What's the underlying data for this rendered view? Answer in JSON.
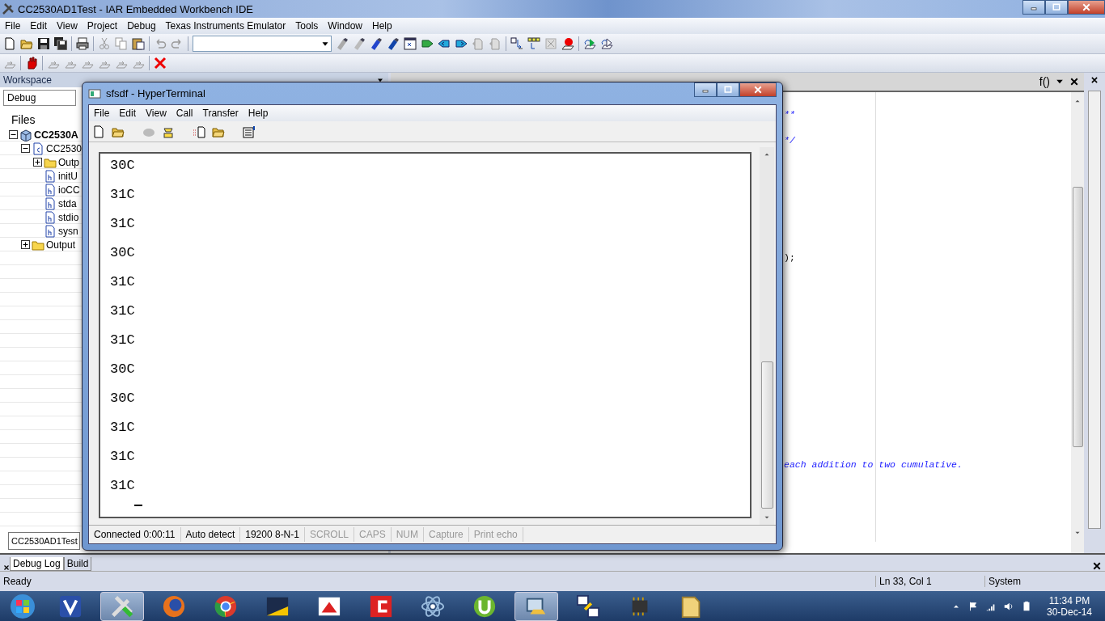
{
  "ide": {
    "title": "CC2530AD1Test - IAR Embedded Workbench IDE",
    "menu": [
      "File",
      "Edit",
      "View",
      "Project",
      "Debug",
      "Texas Instruments Emulator",
      "Tools",
      "Window",
      "Help"
    ],
    "workspace": {
      "title": "Workspace",
      "configuration": "Debug",
      "files_header": "Files",
      "tree": [
        {
          "label": "CC2530A",
          "kind": "project",
          "expanded": true,
          "children": [
            {
              "label": "CC2530",
              "kind": "c",
              "expanded": true,
              "children": [
                {
                  "label": "Outp",
                  "kind": "folder",
                  "expanded": false
                },
                {
                  "label": "initU",
                  "kind": "h"
                },
                {
                  "label": "ioCC",
                  "kind": "h"
                },
                {
                  "label": "stda",
                  "kind": "h"
                },
                {
                  "label": "stdio",
                  "kind": "h"
                },
                {
                  "label": "sysn",
                  "kind": "h"
                }
              ]
            },
            {
              "label": "Output",
              "kind": "folder",
              "expanded": false
            }
          ]
        }
      ],
      "tab": "CC2530AD1Test"
    },
    "editor": {
      "function_button": "f()",
      "lines": [
        {
          "text": "**",
          "kind": "comment"
        },
        {
          "text": "*/",
          "kind": "comment"
        },
        {
          "text": ");",
          "kind": "code"
        },
        {
          "text": "each addition to two cumulative.",
          "kind": "comment"
        }
      ]
    },
    "output_tabs": [
      {
        "label": "Debug Log",
        "selected": true
      },
      {
        "label": "Build",
        "selected": false
      }
    ],
    "status_bar": {
      "message": "Ready",
      "position": "Ln 33, Col 1",
      "mode": "System"
    }
  },
  "terminal": {
    "title": "sfsdf - HyperTerminal",
    "menu": [
      "File",
      "Edit",
      "View",
      "Call",
      "Transfer",
      "Help"
    ],
    "lines": [
      "30C",
      "31C",
      "31C",
      "30C",
      "31C",
      "31C",
      "31C",
      "30C",
      "30C",
      "31C",
      "31C",
      "31C"
    ],
    "status": [
      {
        "text": "Connected 0:00:11",
        "disabled": false
      },
      {
        "text": "Auto detect",
        "disabled": false
      },
      {
        "text": "19200 8-N-1",
        "disabled": false
      },
      {
        "text": "SCROLL",
        "disabled": true
      },
      {
        "text": "CAPS",
        "disabled": true
      },
      {
        "text": "NUM",
        "disabled": true
      },
      {
        "text": "Capture",
        "disabled": true
      },
      {
        "text": "Print echo",
        "disabled": true
      }
    ]
  },
  "taskbar": {
    "time": "11:34 PM",
    "date": "30-Dec-14"
  }
}
